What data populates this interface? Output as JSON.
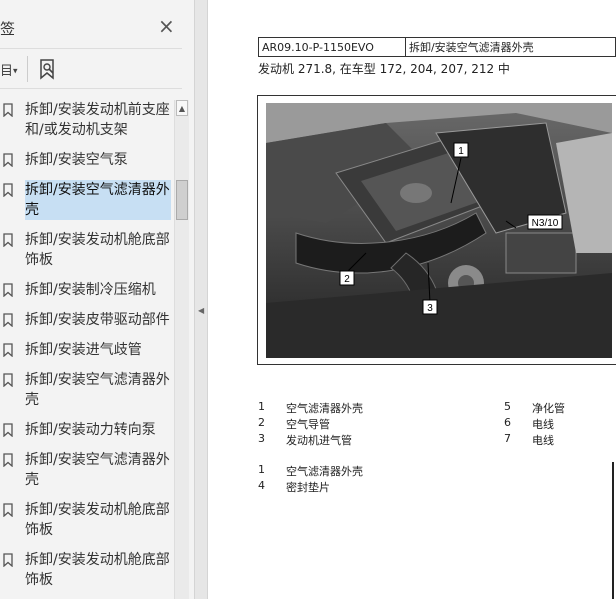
{
  "sidebar": {
    "title": "签",
    "close_glyph": "×",
    "options_glyph": "目",
    "items": [
      {
        "label": "拆卸/安装发动机前支座和/或发动机支架"
      },
      {
        "label": "拆卸/安装空气泵"
      },
      {
        "label": "拆卸/安装空气滤清器外壳",
        "selected": true
      },
      {
        "label": "拆卸/安装发动机舱底部饰板"
      },
      {
        "label": "拆卸/安装制冷压缩机"
      },
      {
        "label": "拆卸/安装皮带驱动部件"
      },
      {
        "label": "拆卸/安装进气歧管"
      },
      {
        "label": "拆卸/安装空气滤清器外壳"
      },
      {
        "label": "拆卸/安装动力转向泵"
      },
      {
        "label": "拆卸/安装空气滤清器外壳"
      },
      {
        "label": "拆卸/安装发动机舱底部饰板"
      },
      {
        "label": "拆卸/安装发动机舱底部饰板"
      }
    ]
  },
  "document": {
    "code": "AR09.10-P-1150EVO",
    "title": "拆卸/安装空气滤清器外壳",
    "engine_line": "发动机   271.8, 在车型 172, 204, 207, 212 中",
    "figure_labels": {
      "l1": "1",
      "l2": "2",
      "l3": "3",
      "n310": "N3/10"
    },
    "legend_left": [
      {
        "num": "1",
        "text": "空气滤清器外壳"
      },
      {
        "num": "2",
        "text": "空气导管"
      },
      {
        "num": "3",
        "text": "发动机进气管"
      }
    ],
    "legend_right": [
      {
        "num": "5",
        "text": "净化管"
      },
      {
        "num": "6",
        "text": "电线"
      },
      {
        "num": "7",
        "text": "电线"
      }
    ],
    "legend_lower": [
      {
        "num": "1",
        "text": "空气滤清器外壳"
      },
      {
        "num": "4",
        "text": "密封垫片"
      }
    ]
  }
}
